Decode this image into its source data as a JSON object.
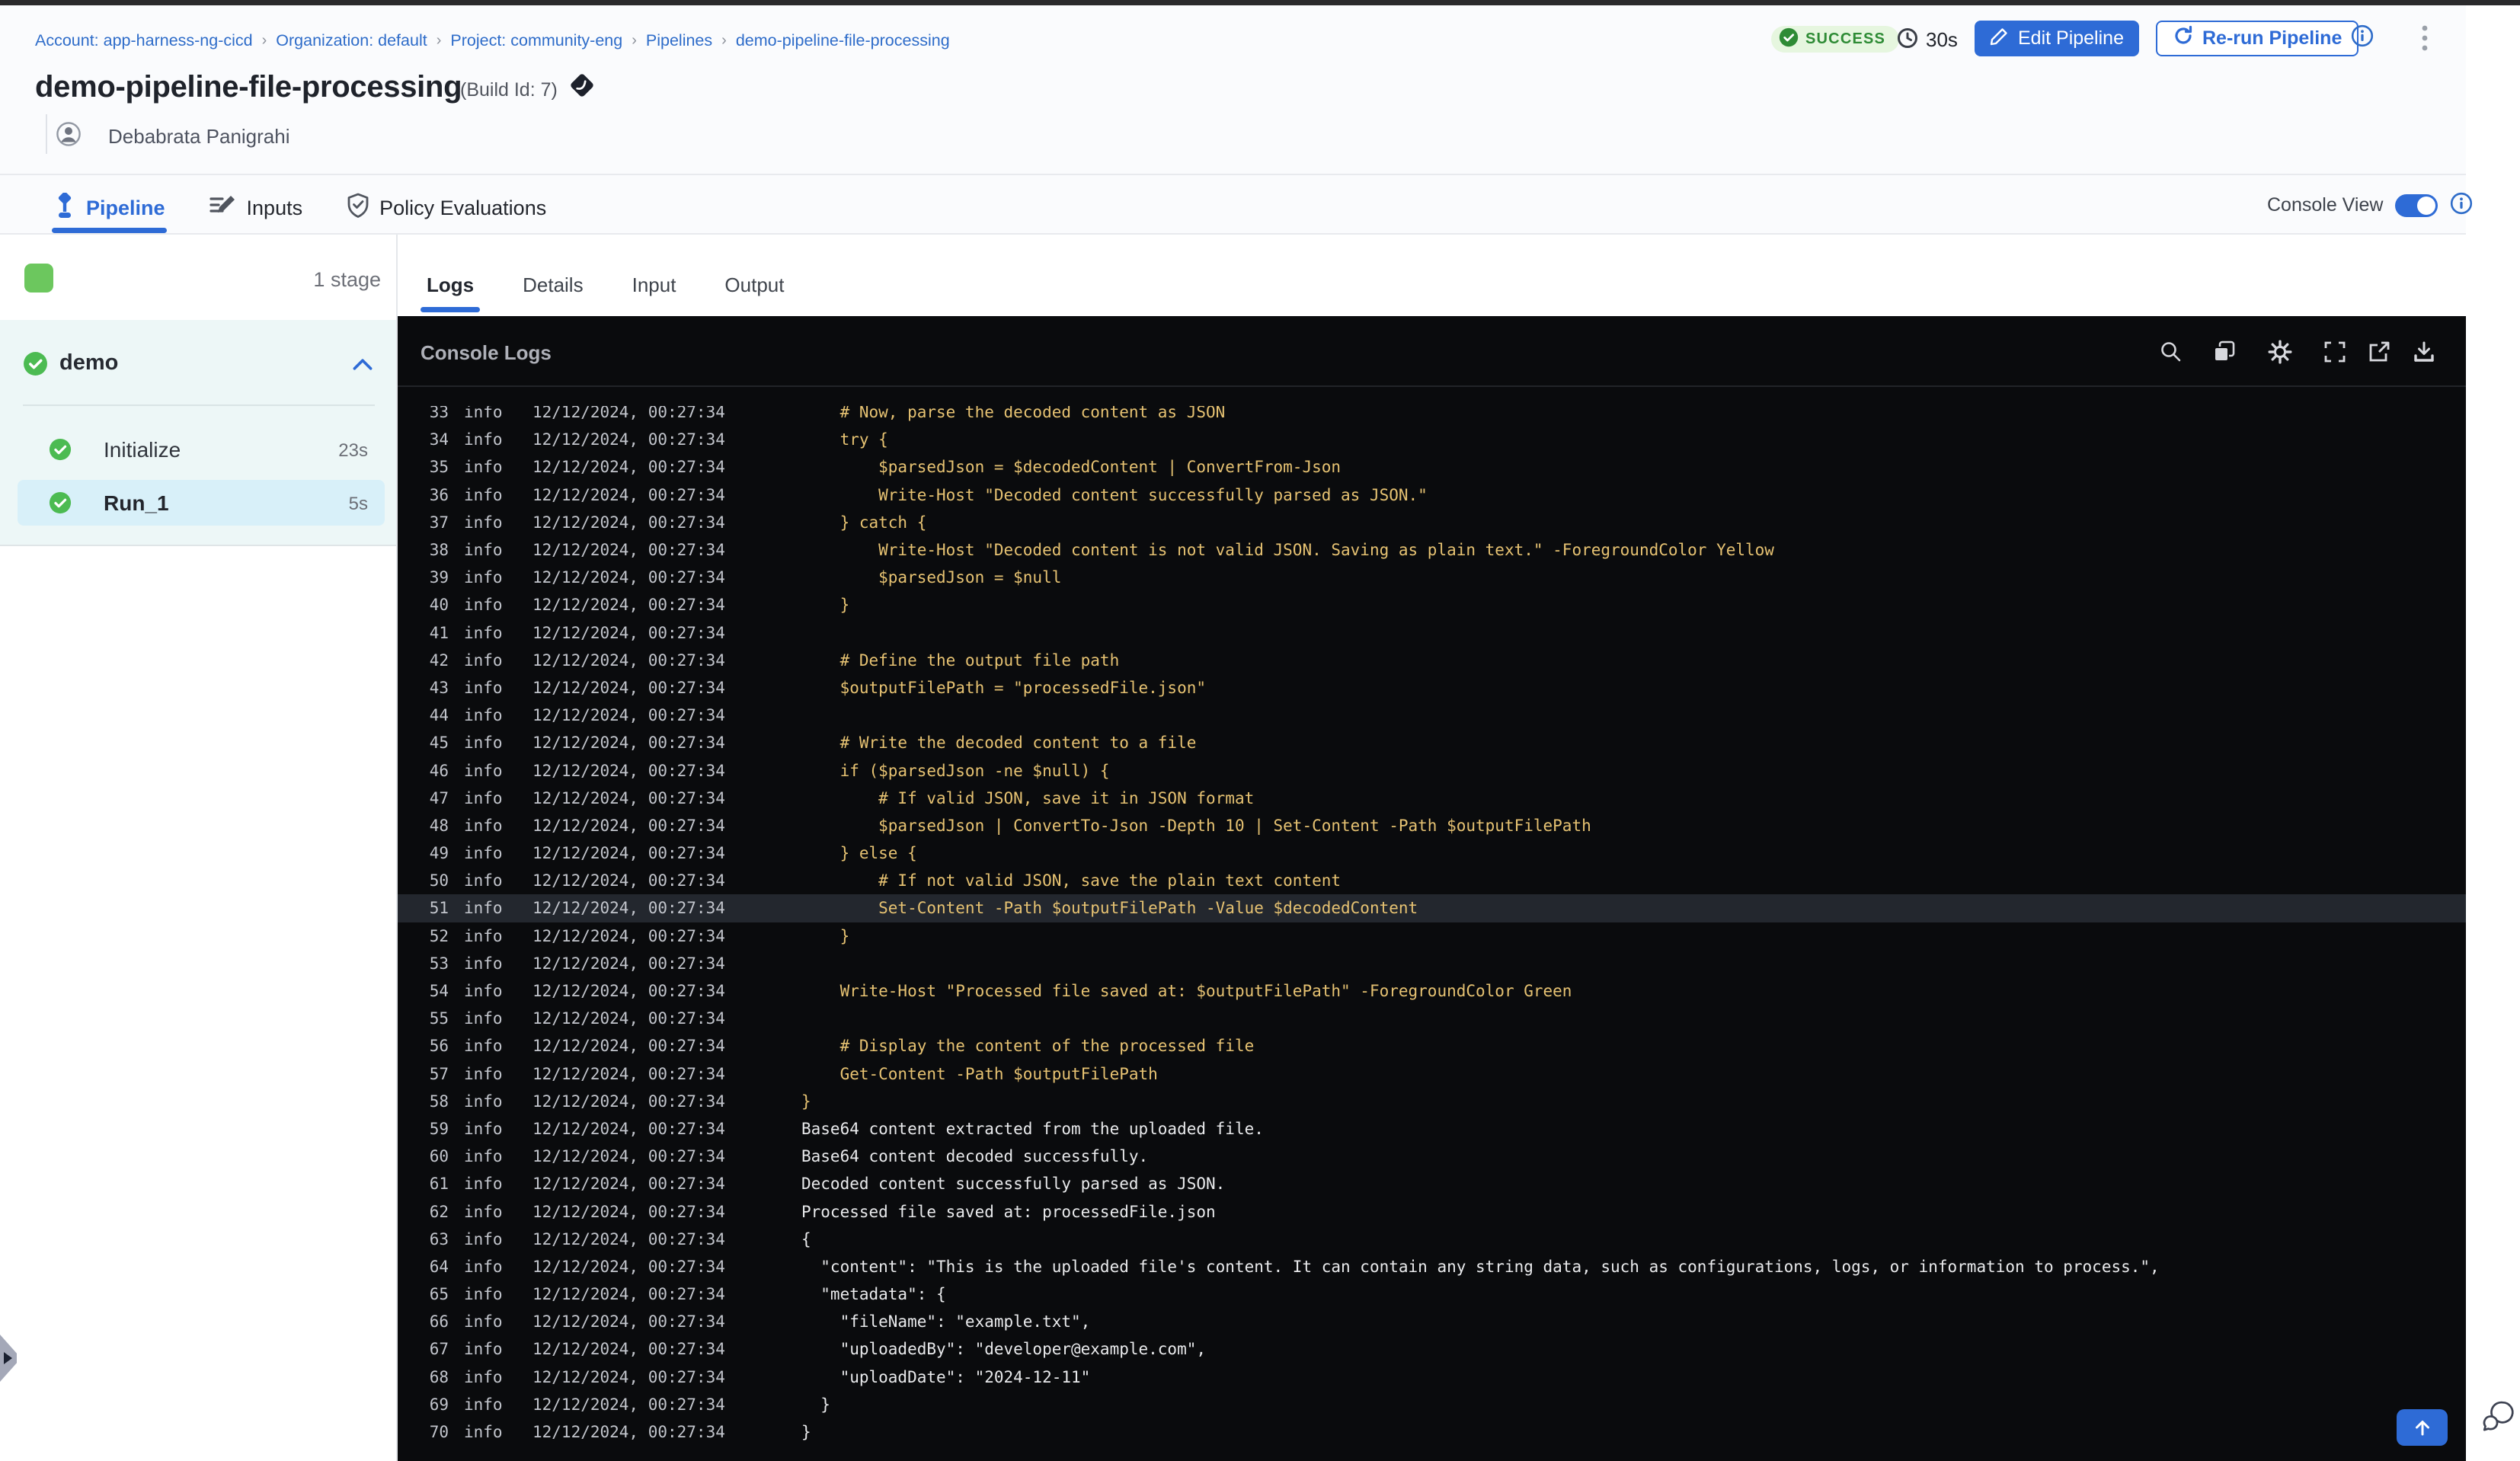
{
  "colors": {
    "primary_blue": "#2e6bd6",
    "link_blue": "#2e6cc9",
    "success_text": "#2e8b35",
    "success_badge_bg": "#e6f6df",
    "stage_green": "#6cc75e",
    "check_green": "#4cbb52",
    "panel_bg": "#edf7f7",
    "selected_step_bg": "#d8f0f9",
    "console_bg": "#0a0b0d",
    "log_code_color": "#e6c272",
    "log_plain_color": "#e9eaec",
    "highlight_row_bg": "#23272e"
  },
  "breadcrumb": {
    "separator": "›",
    "items": [
      "Account: app-harness-ng-cicd",
      "Organization: default",
      "Project: community-eng",
      "Pipelines",
      "demo-pipeline-file-processing"
    ]
  },
  "run_header": {
    "status": "SUCCESS",
    "duration": "30s",
    "edit_button": "Edit Pipeline",
    "rerun_button": "Re-run Pipeline",
    "title": "demo-pipeline-file-processing",
    "build_label": "(Build Id: 7)",
    "author": "Debabrata Panigrahi"
  },
  "view_tabs": [
    {
      "label": "Pipeline",
      "icon": "pipeline",
      "active": true
    },
    {
      "label": "Inputs",
      "icon": "inputs",
      "active": false
    },
    {
      "label": "Policy Evaluations",
      "icon": "policy",
      "active": false
    }
  ],
  "console_view": {
    "label": "Console View",
    "enabled": true
  },
  "stage_panel": {
    "stage_count": "1 stage",
    "stage_name": "demo",
    "steps": [
      {
        "name": "Initialize",
        "duration": "23s",
        "selected": false
      },
      {
        "name": "Run_1",
        "duration": "5s",
        "selected": true
      }
    ]
  },
  "log_tabs": [
    {
      "label": "Logs",
      "active": true
    },
    {
      "label": "Details",
      "active": false
    },
    {
      "label": "Input",
      "active": false
    },
    {
      "label": "Output",
      "active": false
    }
  ],
  "console": {
    "title": "Console Logs",
    "toolbar": [
      "search",
      "copy",
      "settings",
      "fullscreen",
      "open-in-new",
      "download"
    ]
  },
  "logs": {
    "level": "info",
    "timestamp": "12/12/2024, 00:27:34",
    "lines": [
      {
        "n": 33,
        "tone": "code",
        "text": "    # Now, parse the decoded content as JSON"
      },
      {
        "n": 34,
        "tone": "code",
        "text": "    try {"
      },
      {
        "n": 35,
        "tone": "code",
        "text": "        $parsedJson = $decodedContent | ConvertFrom-Json"
      },
      {
        "n": 36,
        "tone": "code",
        "text": "        Write-Host \"Decoded content successfully parsed as JSON.\""
      },
      {
        "n": 37,
        "tone": "code",
        "text": "    } catch {"
      },
      {
        "n": 38,
        "tone": "code",
        "text": "        Write-Host \"Decoded content is not valid JSON. Saving as plain text.\" -ForegroundColor Yellow"
      },
      {
        "n": 39,
        "tone": "code",
        "text": "        $parsedJson = $null"
      },
      {
        "n": 40,
        "tone": "code",
        "text": "    }"
      },
      {
        "n": 41,
        "tone": "code",
        "text": ""
      },
      {
        "n": 42,
        "tone": "code",
        "text": "    # Define the output file path"
      },
      {
        "n": 43,
        "tone": "code",
        "text": "    $outputFilePath = \"processedFile.json\""
      },
      {
        "n": 44,
        "tone": "code",
        "text": ""
      },
      {
        "n": 45,
        "tone": "code",
        "text": "    # Write the decoded content to a file"
      },
      {
        "n": 46,
        "tone": "code",
        "text": "    if ($parsedJson -ne $null) {"
      },
      {
        "n": 47,
        "tone": "code",
        "text": "        # If valid JSON, save it in JSON format"
      },
      {
        "n": 48,
        "tone": "code",
        "text": "        $parsedJson | ConvertTo-Json -Depth 10 | Set-Content -Path $outputFilePath"
      },
      {
        "n": 49,
        "tone": "code",
        "text": "    } else {"
      },
      {
        "n": 50,
        "tone": "code",
        "text": "        # If not valid JSON, save the plain text content"
      },
      {
        "n": 51,
        "tone": "code",
        "highlighted": true,
        "text": "        Set-Content -Path $outputFilePath -Value $decodedContent"
      },
      {
        "n": 52,
        "tone": "code",
        "text": "    }"
      },
      {
        "n": 53,
        "tone": "code",
        "text": ""
      },
      {
        "n": 54,
        "tone": "code",
        "text": "    Write-Host \"Processed file saved at: $outputFilePath\" -ForegroundColor Green"
      },
      {
        "n": 55,
        "tone": "code",
        "text": ""
      },
      {
        "n": 56,
        "tone": "code",
        "text": "    # Display the content of the processed file"
      },
      {
        "n": 57,
        "tone": "code",
        "text": "    Get-Content -Path $outputFilePath"
      },
      {
        "n": 58,
        "tone": "code",
        "text": "}"
      },
      {
        "n": 59,
        "tone": "plain",
        "text": "Base64 content extracted from the uploaded file."
      },
      {
        "n": 60,
        "tone": "plain",
        "text": "Base64 content decoded successfully."
      },
      {
        "n": 61,
        "tone": "plain",
        "text": "Decoded content successfully parsed as JSON."
      },
      {
        "n": 62,
        "tone": "plain",
        "text": "Processed file saved at: processedFile.json"
      },
      {
        "n": 63,
        "tone": "plain",
        "text": "{"
      },
      {
        "n": 64,
        "tone": "plain",
        "text": "  \"content\": \"This is the uploaded file's content. It can contain any string data, such as configurations, logs, or information to process.\","
      },
      {
        "n": 65,
        "tone": "plain",
        "text": "  \"metadata\": {"
      },
      {
        "n": 66,
        "tone": "plain",
        "text": "    \"fileName\": \"example.txt\","
      },
      {
        "n": 67,
        "tone": "plain",
        "text": "    \"uploadedBy\": \"developer@example.com\","
      },
      {
        "n": 68,
        "tone": "plain",
        "text": "    \"uploadDate\": \"2024-12-11\""
      },
      {
        "n": 69,
        "tone": "plain",
        "text": "  }"
      },
      {
        "n": 70,
        "tone": "plain",
        "text": "}"
      }
    ]
  }
}
